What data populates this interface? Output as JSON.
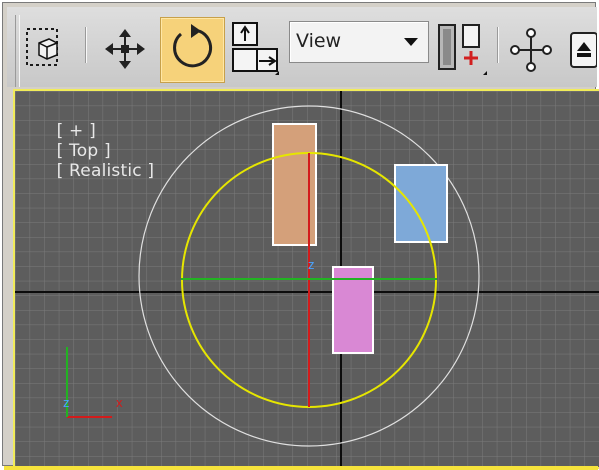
{
  "toolbar": {
    "view_dropdown": {
      "selected": "View"
    },
    "icons": [
      "select-region-icon",
      "box-select-icon",
      "move-icon",
      "rotate-icon",
      "scale-icon",
      "view-dropdown",
      "pivot-icon",
      "link-icon",
      "selection-filter-icon"
    ]
  },
  "viewport": {
    "label_plus": "[ + ]",
    "label_view": "[ Top ]",
    "label_shading": "[ Realistic ]",
    "axis_tripod": {
      "x": "x",
      "z": "z"
    },
    "gizmo_label": "z"
  },
  "colors": {
    "viewport_bg": "#5d5d5d",
    "grid": "#7b7b7b",
    "active_border": "#f1ec5a",
    "active_button": "#f6d27a",
    "object_tan": "#d4a07a",
    "object_blue": "#7ea9d8",
    "object_pink": "#d988d4",
    "gizmo_yellow": "#e6e600",
    "gizmo_red": "#d31b1b",
    "gizmo_green": "#22b322"
  }
}
